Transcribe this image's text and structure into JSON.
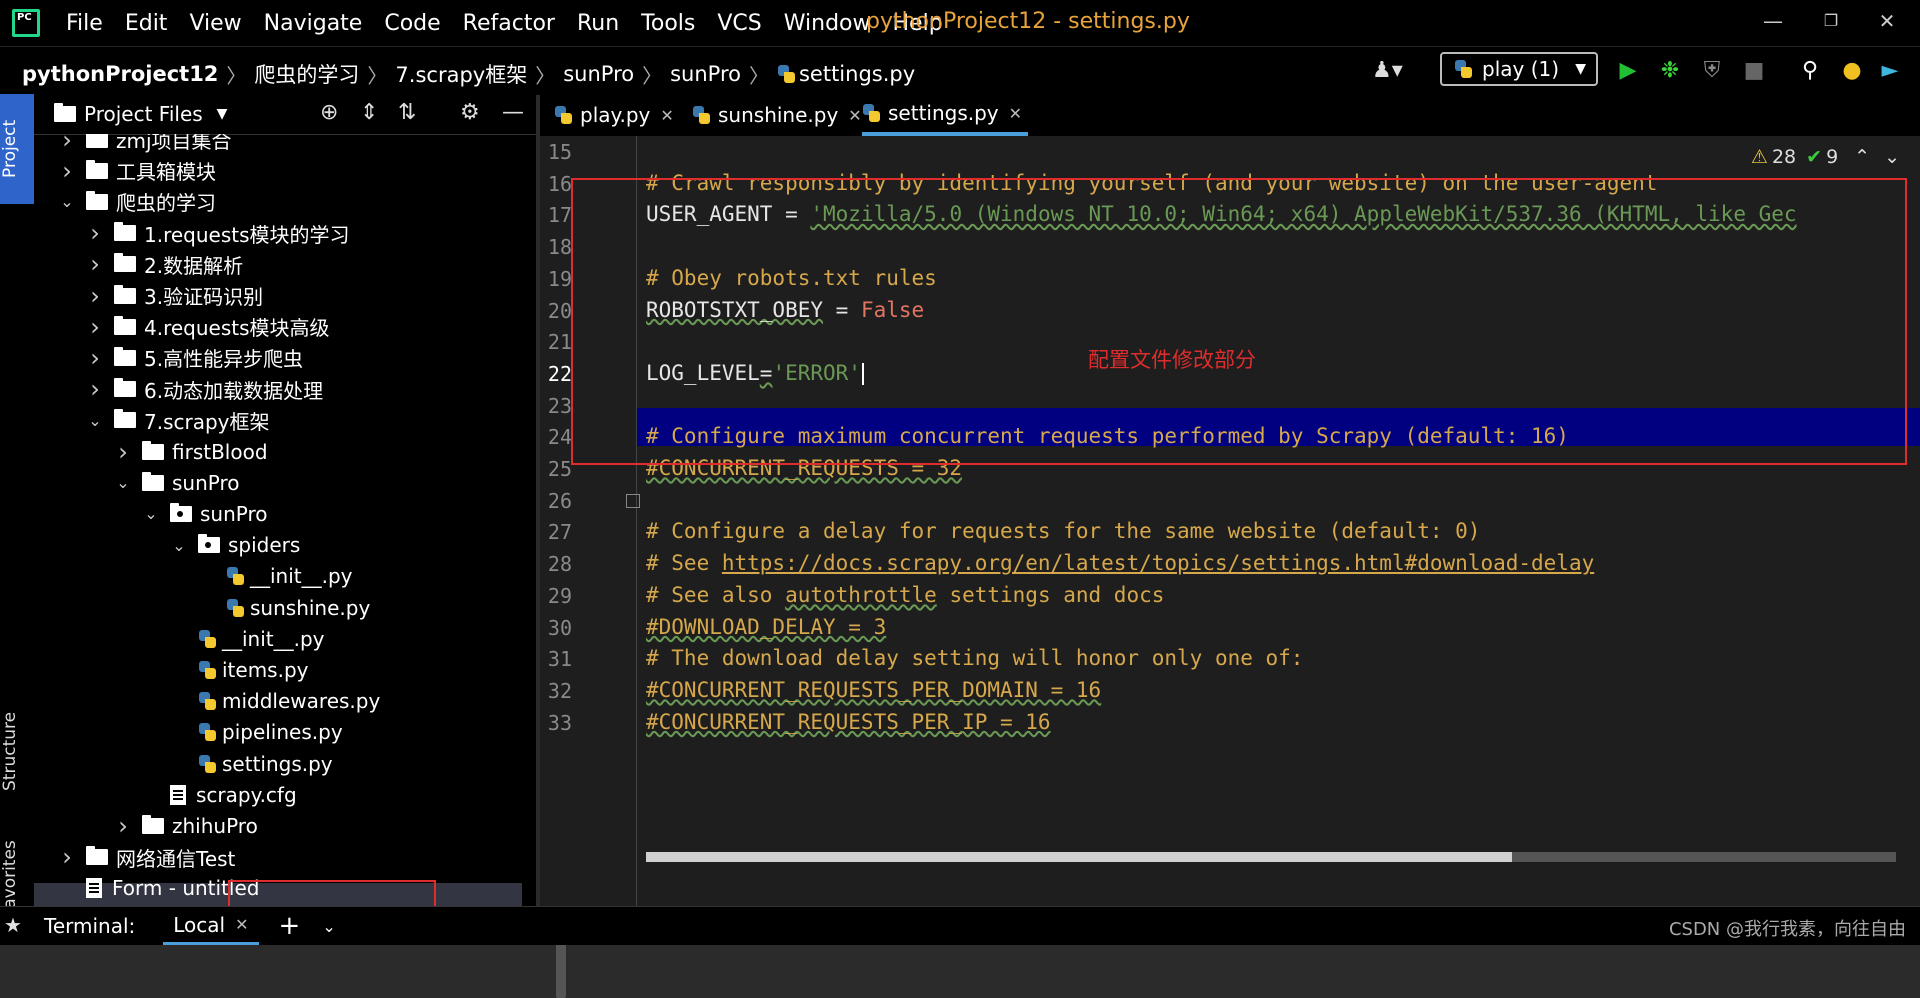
{
  "window": {
    "title": "pythonProject12 - settings.py"
  },
  "menu": [
    "File",
    "Edit",
    "View",
    "Navigate",
    "Code",
    "Refactor",
    "Run",
    "Tools",
    "VCS",
    "Window",
    "Help"
  ],
  "breadcrumb": [
    "pythonProject12",
    "爬虫的学习",
    "7.scrapy框架",
    "sunPro",
    "sunPro",
    "settings.py"
  ],
  "run_config": {
    "label": "play (1)"
  },
  "left_strip": {
    "project": "Project",
    "structure": "Structure",
    "favorites": "Favorites"
  },
  "project_panel": {
    "title": "Project Files",
    "tree": [
      {
        "label": "zmj项目集合",
        "level": 1,
        "type": "folder",
        "expanded": false
      },
      {
        "label": "工具箱模块",
        "level": 1,
        "type": "folder",
        "expanded": false
      },
      {
        "label": "爬虫的学习",
        "level": 1,
        "type": "folder",
        "expanded": true
      },
      {
        "label": "1.requests模块的学习",
        "level": 2,
        "type": "folder",
        "expanded": false
      },
      {
        "label": "2.数据解析",
        "level": 2,
        "type": "folder",
        "expanded": false
      },
      {
        "label": "3.验证码识别",
        "level": 2,
        "type": "folder",
        "expanded": false
      },
      {
        "label": "4.requests模块高级",
        "level": 2,
        "type": "folder",
        "expanded": false
      },
      {
        "label": "5.高性能异步爬虫",
        "level": 2,
        "type": "folder",
        "expanded": false
      },
      {
        "label": "6.动态加载数据处理",
        "level": 2,
        "type": "folder",
        "expanded": false
      },
      {
        "label": "7.scrapy框架",
        "level": 2,
        "type": "folder",
        "expanded": true
      },
      {
        "label": "firstBlood",
        "level": 3,
        "type": "folder",
        "expanded": false
      },
      {
        "label": "sunPro",
        "level": 3,
        "type": "folder",
        "expanded": true
      },
      {
        "label": "sunPro",
        "level": 4,
        "type": "package",
        "expanded": true
      },
      {
        "label": "spiders",
        "level": 5,
        "type": "package",
        "expanded": true
      },
      {
        "label": "__init__.py",
        "level": 6,
        "type": "py"
      },
      {
        "label": "sunshine.py",
        "level": 6,
        "type": "py"
      },
      {
        "label": "__init__.py",
        "level": 5,
        "type": "py"
      },
      {
        "label": "items.py",
        "level": 5,
        "type": "py"
      },
      {
        "label": "middlewares.py",
        "level": 5,
        "type": "py"
      },
      {
        "label": "pipelines.py",
        "level": 5,
        "type": "py"
      },
      {
        "label": "settings.py",
        "level": 5,
        "type": "py",
        "selected": true
      },
      {
        "label": "scrapy.cfg",
        "level": 4,
        "type": "file"
      },
      {
        "label": "zhihuPro",
        "level": 3,
        "type": "folder",
        "expanded": false
      },
      {
        "label": "网络通信Test",
        "level": 1,
        "type": "folder",
        "expanded": false
      },
      {
        "label": "Form - untitled",
        "level": 1,
        "type": "file"
      }
    ]
  },
  "editor_tabs": [
    {
      "label": "play.py",
      "active": false
    },
    {
      "label": "sunshine.py",
      "active": false
    },
    {
      "label": "settings.py",
      "active": true
    }
  ],
  "inspections": {
    "warnings": "28",
    "ok": "9"
  },
  "code": [
    {
      "n": "15",
      "parts": []
    },
    {
      "n": "16",
      "parts": [
        {
          "t": "# Crawl responsibly by identifying yourself (and your website) on the user-agent",
          "c": "comment"
        }
      ]
    },
    {
      "n": "17",
      "parts": [
        {
          "t": "USER_AGENT = ",
          "c": "plain"
        },
        {
          "t": "'Mozilla/5.0 (Windows NT 10.0; Win64; x64) AppleWebKit/537.36 (KHTML, like Gec",
          "c": "string-wavy"
        }
      ]
    },
    {
      "n": "18",
      "parts": []
    },
    {
      "n": "19",
      "parts": [
        {
          "t": "# Obey robots.txt rules",
          "c": "comment"
        }
      ]
    },
    {
      "n": "20",
      "parts": [
        {
          "t": "ROBOTSTXT_OBEY",
          "c": "plain-wavy"
        },
        {
          "t": " = ",
          "c": "plain"
        },
        {
          "t": "False",
          "c": "kw"
        }
      ]
    },
    {
      "n": "21",
      "parts": []
    },
    {
      "n": "22",
      "parts": [
        {
          "t": "LOG_LEVEL",
          "c": "plain"
        },
        {
          "t": "=",
          "c": "plain-wavy"
        },
        {
          "t": "'ERROR'",
          "c": "string"
        }
      ]
    },
    {
      "n": "23",
      "parts": []
    },
    {
      "n": "24",
      "parts": [
        {
          "t": "# Configure maximum concurrent requests performed by Scrapy (default: 16)",
          "c": "comment"
        }
      ]
    },
    {
      "n": "25",
      "parts": [
        {
          "t": "#CONCURRENT_REQUESTS = 32",
          "c": "comment-wavy"
        }
      ]
    },
    {
      "n": "26",
      "parts": []
    },
    {
      "n": "27",
      "parts": [
        {
          "t": "# Configure a delay for requests for the same website (default: 0)",
          "c": "comment"
        }
      ]
    },
    {
      "n": "28",
      "parts": [
        {
          "t": "# See ",
          "c": "comment"
        },
        {
          "t": "https://docs.scrapy.org/en/latest/topics/settings.html#download-delay",
          "c": "link"
        }
      ]
    },
    {
      "n": "29",
      "parts": [
        {
          "t": "# See also ",
          "c": "comment"
        },
        {
          "t": "autothrottle",
          "c": "comment-wavy"
        },
        {
          "t": " settings and docs",
          "c": "comment"
        }
      ]
    },
    {
      "n": "30",
      "parts": [
        {
          "t": "#DOWNLOAD_DELAY = 3",
          "c": "comment-wavy"
        }
      ]
    },
    {
      "n": "31",
      "parts": [
        {
          "t": "# The download delay setting will honor only one of:",
          "c": "comment"
        }
      ]
    },
    {
      "n": "32",
      "parts": [
        {
          "t": "#CONCURRENT_REQUESTS_PER_DOMAIN = 16",
          "c": "comment-wavy"
        }
      ]
    },
    {
      "n": "33",
      "parts": [
        {
          "t": "#CONCURRENT_REQUESTS_PER_IP = 16",
          "c": "comment-wavy"
        }
      ]
    }
  ],
  "annotation": "配置文件修改部分",
  "bottom": {
    "terminal": "Terminal:",
    "local": "Local",
    "watermark": "CSDN @我行我素，向往自由"
  }
}
